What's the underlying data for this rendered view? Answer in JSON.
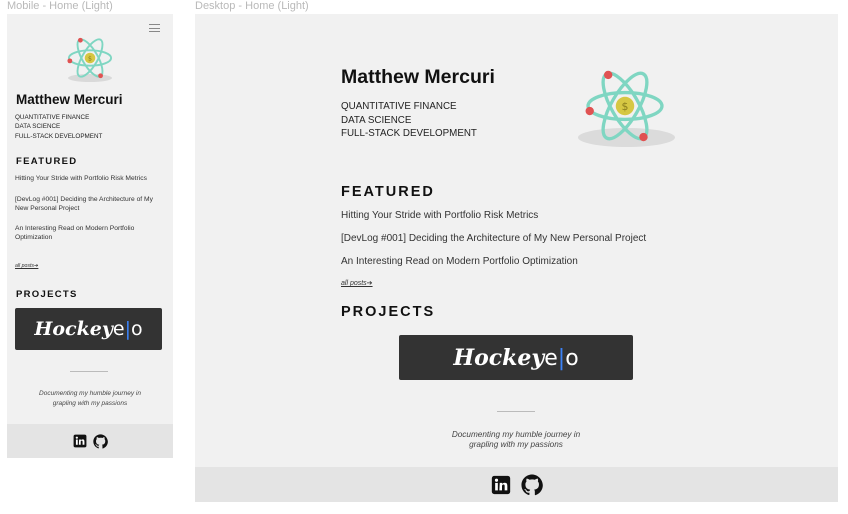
{
  "frames": {
    "mobile_label": "Mobile - Home (Light)",
    "desktop_label": "Desktop - Home (Light)"
  },
  "profile": {
    "name": "Matthew Mercuri",
    "tags": [
      "QUANTITATIVE FINANCE",
      "DATA SCIENCE",
      "FULL-STACK DEVELOPMENT"
    ]
  },
  "featured": {
    "heading": "FEATURED",
    "posts": [
      "Hitting Your Stride with Portfolio Risk Metrics",
      "[DevLog #001] Deciding the Architecture of My New Personal Project",
      "An Interesting Read on Modern Portfolio Optimization"
    ],
    "all_posts_label": "all posts➔"
  },
  "projects": {
    "heading": "PROJECTS",
    "hockey_logo": {
      "word": "Hockey",
      "e": "e",
      "bar": "|",
      "o": "o"
    }
  },
  "tagline": [
    "Documenting my humble journey in",
    "grapling with my passions"
  ],
  "icons": {
    "linkedin": "linkedin-icon",
    "github": "github-icon",
    "menu": "hamburger-menu-icon",
    "atom": "atom-dollar-logo"
  },
  "colors": {
    "frame_bg": "#f1f1f1",
    "footer_bg": "#e4e4e4",
    "banner_bg": "#333333",
    "atom_orbit": "#7fd6c2",
    "atom_electron": "#e05252",
    "atom_nucleus": "#d6c743",
    "logo_accent": "#3b82f6"
  }
}
